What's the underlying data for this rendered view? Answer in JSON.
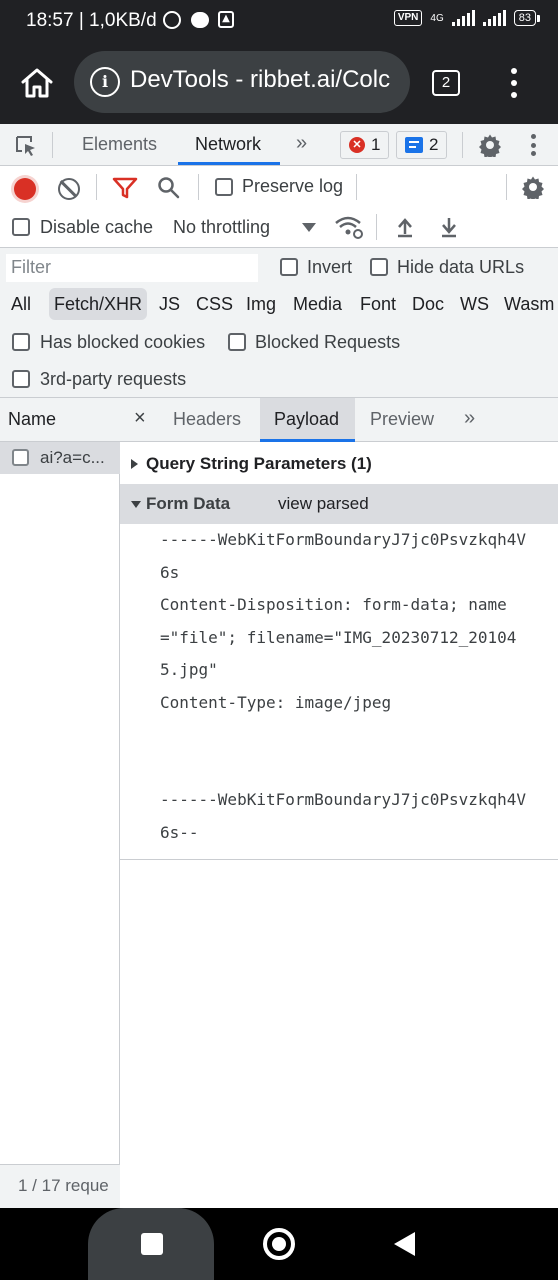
{
  "status_bar": {
    "time": "18:57 | 1,0KB/d",
    "vpn": "VPN",
    "network": "4G",
    "battery": "83"
  },
  "chrome": {
    "url": "DevTools - ribbet.ai/Colc",
    "tab_count": "2"
  },
  "devtools_tabs": {
    "elements": "Elements",
    "network": "Network",
    "more": "»",
    "errors_count": "1",
    "messages_count": "2"
  },
  "network_toolbar": {
    "preserve_log": "Preserve log",
    "disable_cache": "Disable cache",
    "throttling": "No throttling"
  },
  "filter_bar": {
    "filter_placeholder": "Filter",
    "invert": "Invert",
    "hide_data_urls": "Hide data URLs",
    "types": [
      "All",
      "Fetch/XHR",
      "JS",
      "CSS",
      "Img",
      "Media",
      "Font",
      "Doc",
      "WS",
      "Wasm"
    ],
    "active_type": "Fetch/XHR",
    "has_blocked_cookies": "Has blocked cookies",
    "blocked_requests": "Blocked Requests",
    "third_party": "3rd-party requests"
  },
  "requests": {
    "column_name": "Name",
    "rows": [
      "ai?a=c..."
    ],
    "summary": "1 / 17 reque"
  },
  "details": {
    "close": "×",
    "tabs": [
      "Headers",
      "Payload",
      "Preview"
    ],
    "more": "»",
    "active_tab": "Payload",
    "query_section": "Query String Parameters (1)",
    "form_section": "Form Data",
    "view_parsed": "view parsed",
    "form_lines": [
      "------WebKitFormBoundaryJ7jc0Psvzkqh4V",
      "6s",
      "Content-Disposition: form-data; name",
      "=\"file\"; filename=\"IMG_20230712_20104",
      "5.jpg\"",
      "Content-Type: image/jpeg",
      "",
      "",
      "------WebKitFormBoundaryJ7jc0Psvzkqh4V",
      "6s--"
    ]
  }
}
